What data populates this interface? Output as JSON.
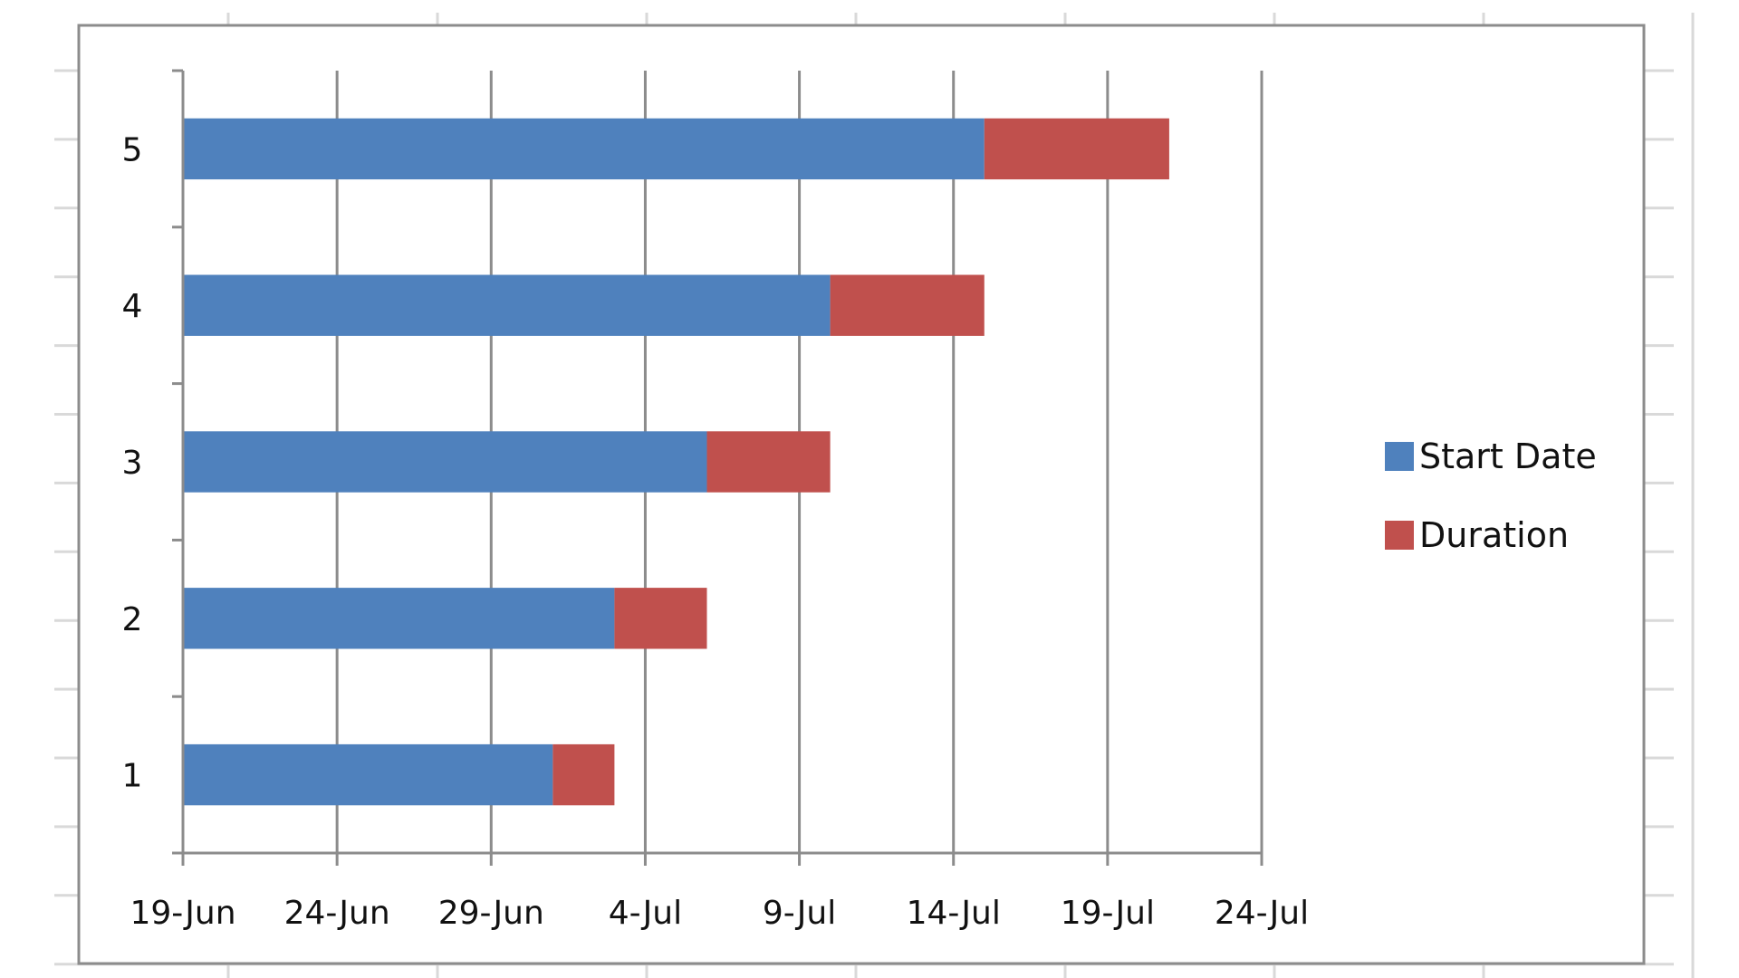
{
  "chart_data": {
    "type": "bar",
    "orientation": "horizontal",
    "stacked": true,
    "title": "",
    "xlabel": "",
    "ylabel": "",
    "categories": [
      "1",
      "2",
      "3",
      "4",
      "5"
    ],
    "series": [
      {
        "name": "Start Date",
        "color": "#4f81bd",
        "values": [
          "1-Jul",
          "3-Jul",
          "6-Jul",
          "10-Jul",
          "15-Jul"
        ],
        "days_from_axis_min": [
          12,
          14,
          17,
          21,
          26
        ]
      },
      {
        "name": "Duration",
        "color": "#c0504d",
        "values": [
          2,
          3,
          4,
          5,
          6
        ]
      }
    ],
    "x_axis": {
      "min": "19-Jun",
      "max": "24-Jul",
      "range_days": 35,
      "major_unit_days": 5,
      "tick_labels": [
        "19-Jun",
        "24-Jun",
        "29-Jun",
        "4-Jul",
        "9-Jul",
        "14-Jul",
        "19-Jul",
        "24-Jul"
      ]
    },
    "y_axis": {
      "tick_labels": [
        "1",
        "2",
        "3",
        "4",
        "5"
      ]
    },
    "grid": {
      "vertical_major": true,
      "horizontal": false
    },
    "legend": {
      "position": "right",
      "entries": [
        {
          "label": "Start Date",
          "color": "#4f81bd"
        },
        {
          "label": "Duration",
          "color": "#c0504d"
        }
      ]
    }
  },
  "colors": {
    "axis": "#8c8c8c",
    "frame": "#8c8c8c",
    "sheet_gridline": "#d9d9d9"
  }
}
